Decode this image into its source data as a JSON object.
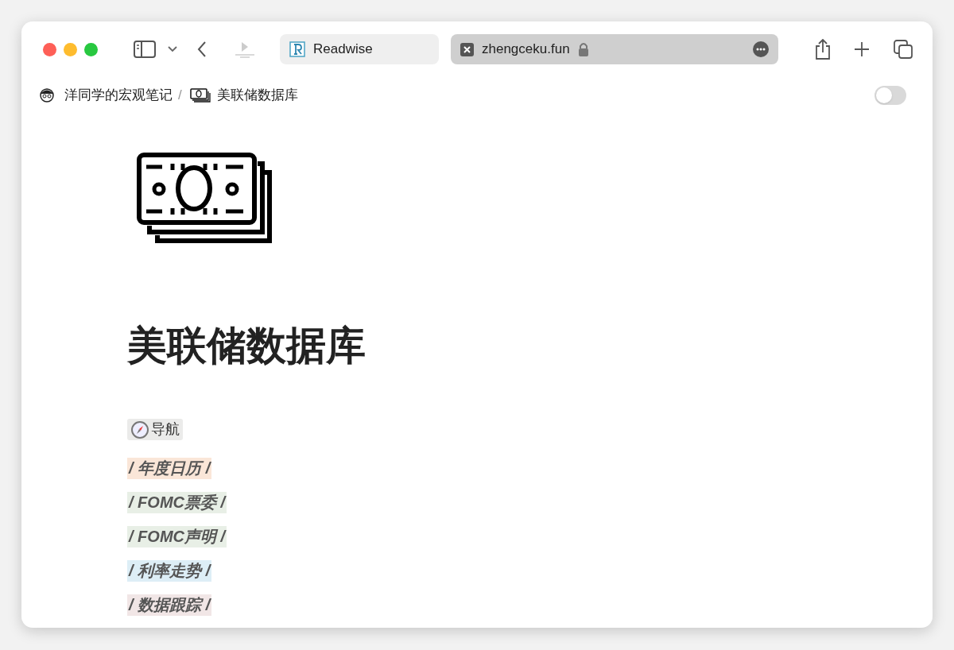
{
  "tabs": [
    {
      "label": "Readwise",
      "selected": false
    },
    {
      "label": "zhengceku.fun",
      "selected": true
    }
  ],
  "breadcrumb": [
    "洋同学的宏观笔记",
    "美联储数据库"
  ],
  "breadcrumb_separator": "/",
  "toggle": {
    "on": false
  },
  "page_title": "美联储数据库",
  "nav_label": "导航",
  "links": [
    {
      "text": "/ 年度日历 /",
      "color": "#fae6d8"
    },
    {
      "text": "/ FOMC票委 /",
      "color": "#e8efe6"
    },
    {
      "text": "/ FOMC声明 /",
      "color": "#e8efe6"
    },
    {
      "text": "/ 利率走势 /",
      "color": "#ddeef6"
    },
    {
      "text": "/ 数据跟踪 /",
      "color": "#f1e6e6"
    }
  ]
}
